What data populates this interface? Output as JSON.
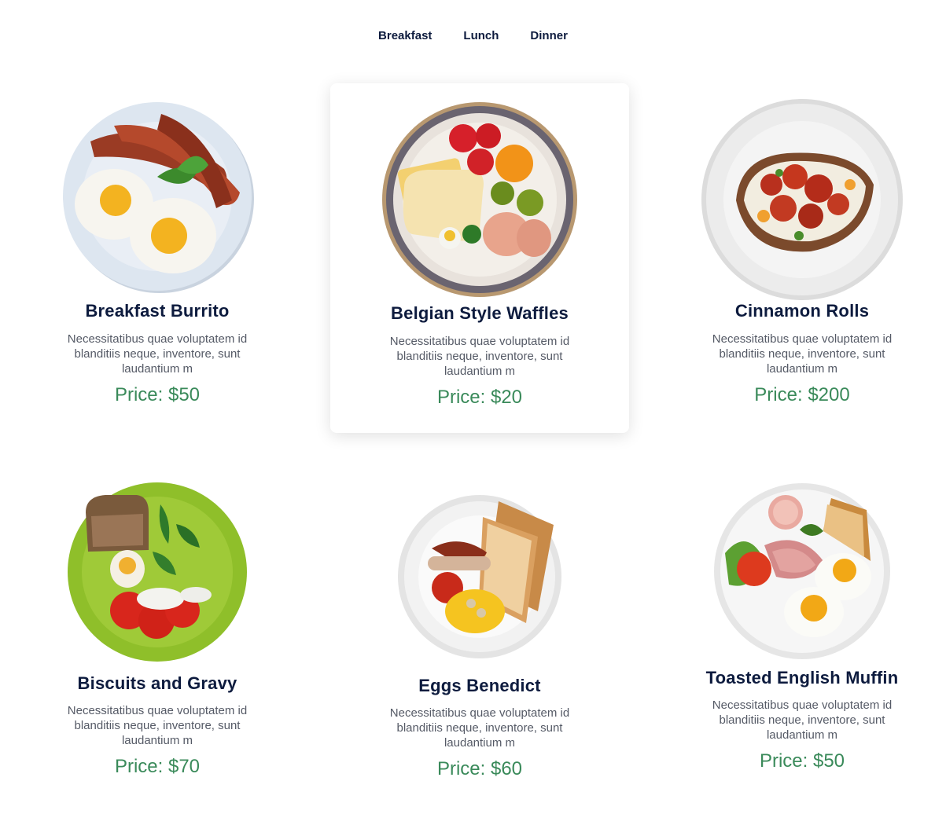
{
  "tabs": [
    {
      "label": "Breakfast"
    },
    {
      "label": "Lunch"
    },
    {
      "label": "Dinner"
    }
  ],
  "items": [
    {
      "title": "Breakfast Burrito",
      "description": "Necessitatibus quae voluptatem id blanditiis neque, inventore, sunt laudantium m",
      "price": "Price: $50",
      "image": "fried-eggs-bacon-plate"
    },
    {
      "title": "Belgian Style Waffles",
      "description": "Necessitatibus quae voluptatem id blanditiis neque, inventore, sunt laudantium m",
      "price": "Price: $20",
      "image": "toast-fruit-ham-plate"
    },
    {
      "title": "Cinnamon Rolls",
      "description": "Necessitatibus quae voluptatem id blanditiis neque, inventore, sunt laudantium m",
      "price": "Price: $200",
      "image": "loaded-baked-potato-plate"
    },
    {
      "title": "Biscuits and Gravy",
      "description": "Necessitatibus quae voluptatem id blanditiis neque, inventore, sunt laudantium m",
      "price": "Price: $70",
      "image": "bread-egg-tomato-green-plate"
    },
    {
      "title": "Eggs Benedict",
      "description": "Necessitatibus quae voluptatem id blanditiis neque, inventore, sunt laudantium m",
      "price": "Price: $60",
      "image": "toast-scrambled-eggs-sausage-plate"
    },
    {
      "title": "Toasted English Muffin",
      "description": "Necessitatibus quae voluptatem id blanditiis neque, inventore, sunt laudantium m",
      "price": "Price: $50",
      "image": "toast-ham-eggs-salad-plate"
    }
  ],
  "colors": {
    "title": "#0d1b3e",
    "price": "#3a8a5a",
    "description": "#555a66",
    "active_card_bg": "#ffffff"
  }
}
